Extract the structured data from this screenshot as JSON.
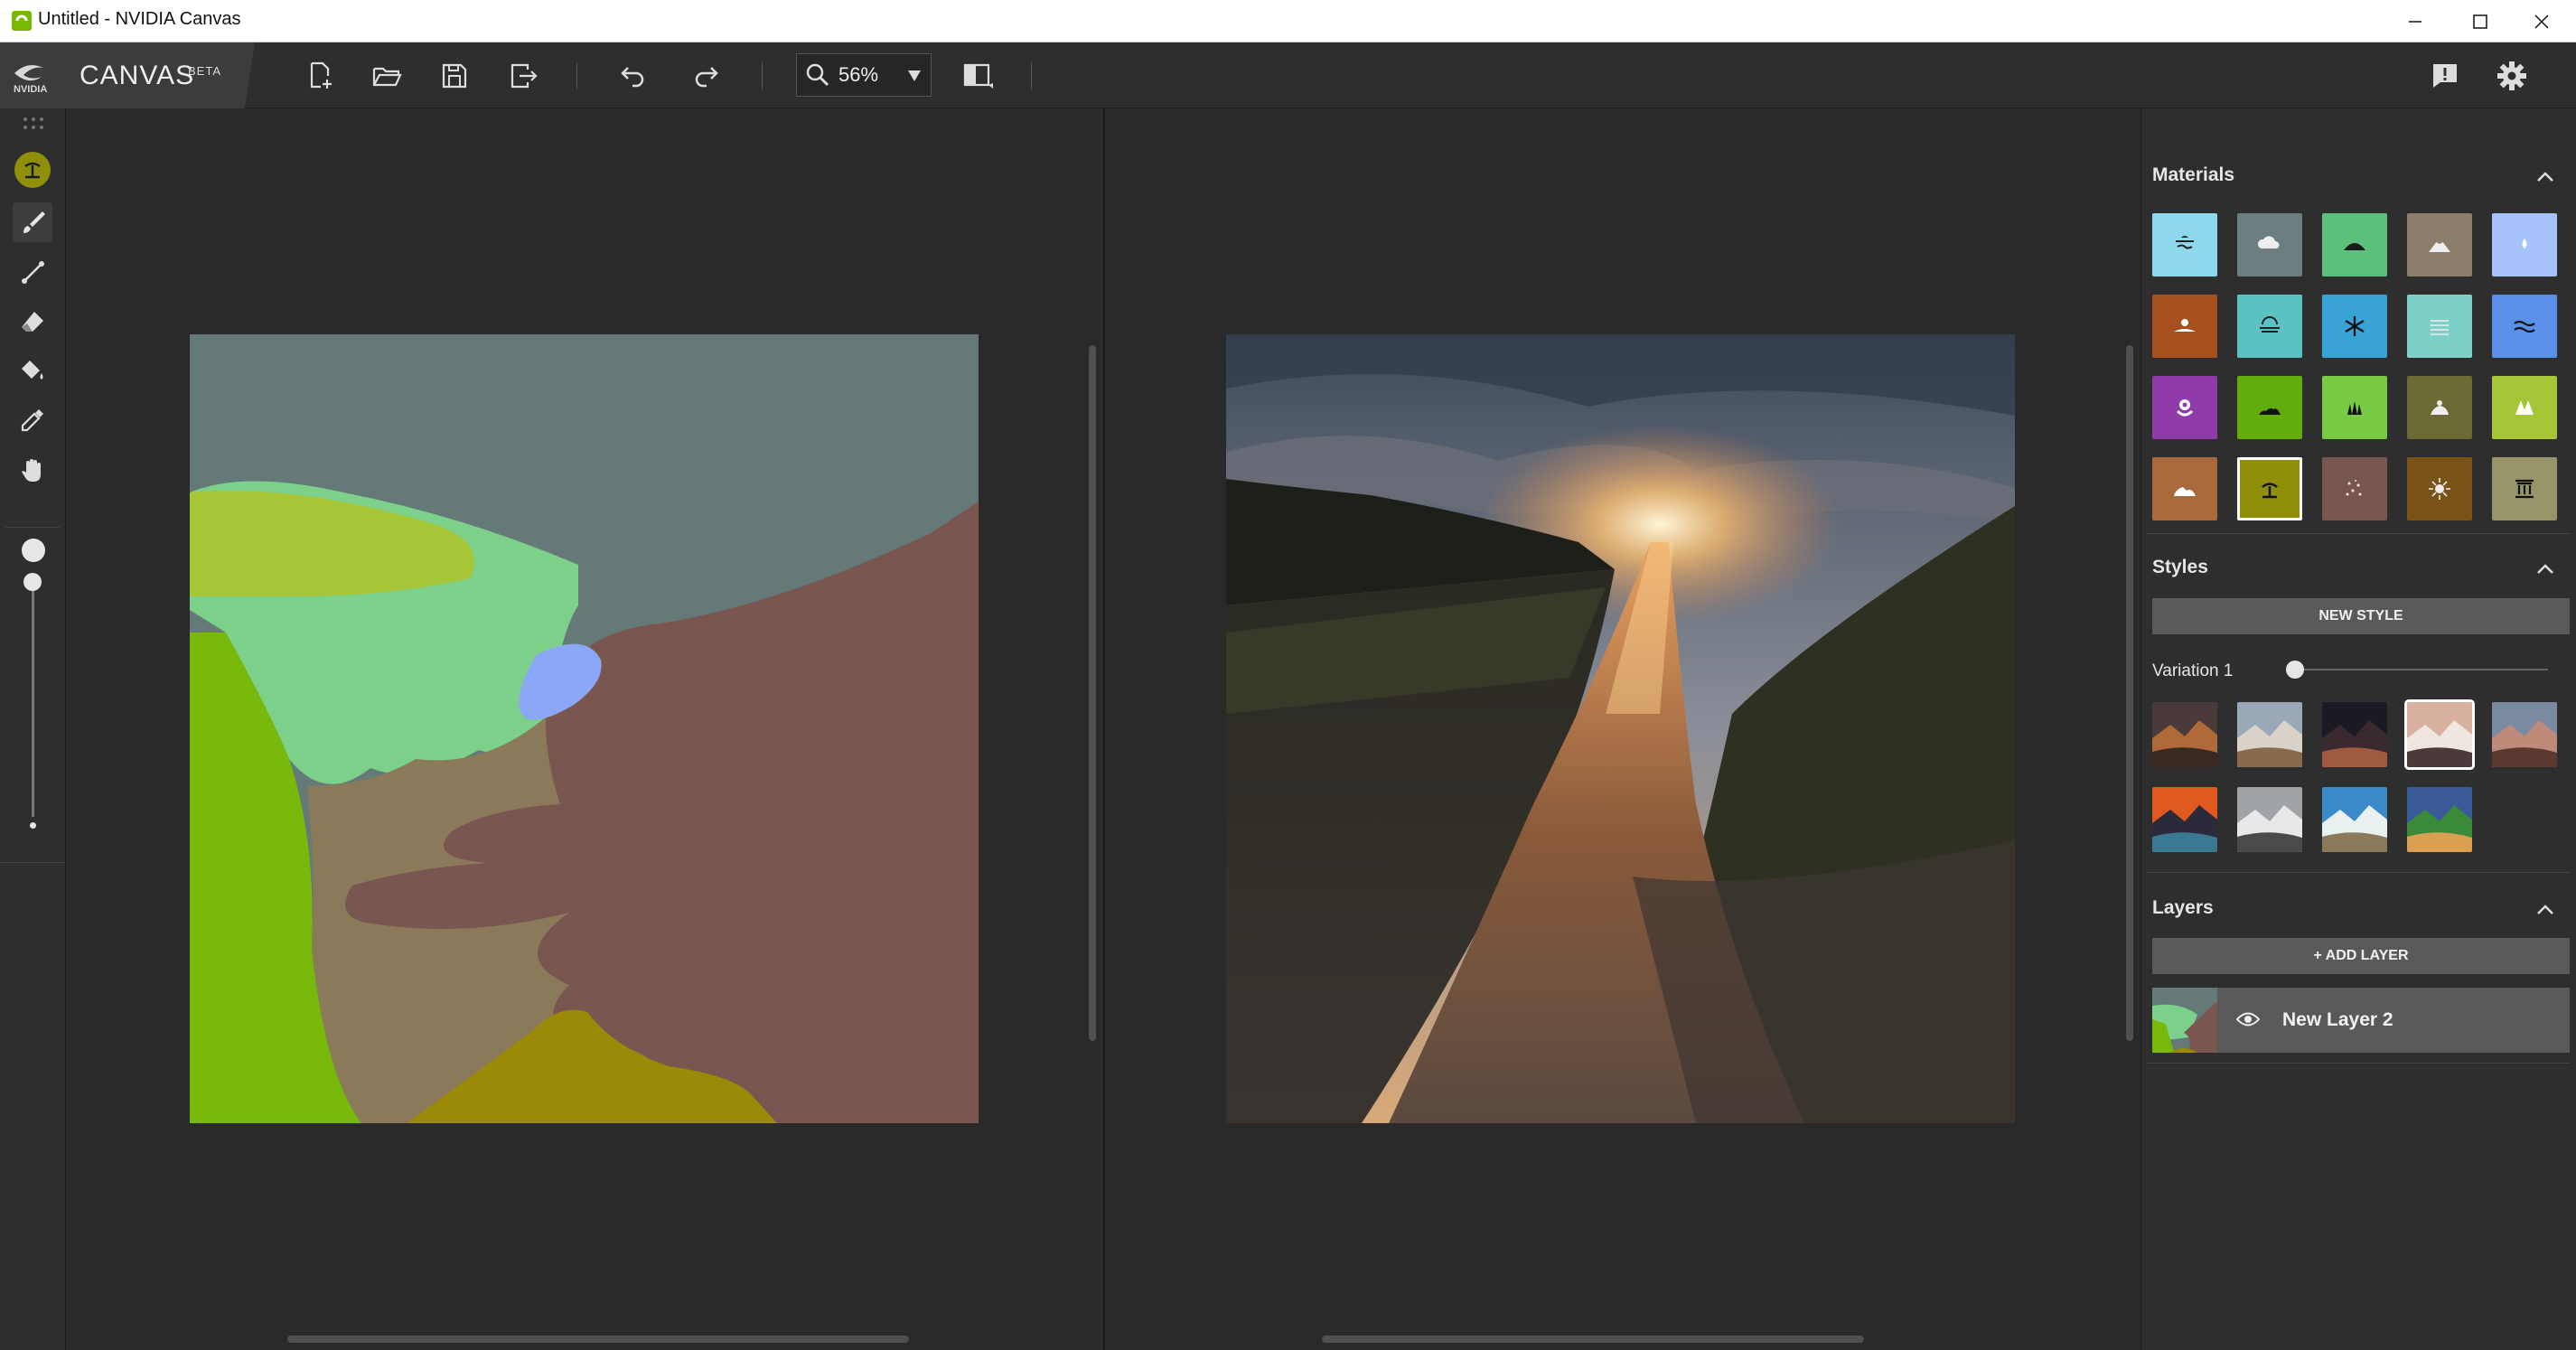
{
  "window": {
    "title": "Untitled - NVIDIA Canvas",
    "controls": [
      "minimize",
      "maximize",
      "close"
    ]
  },
  "brand": {
    "logo_text": "NVIDIA",
    "app_name": "CANVAS",
    "badge": "BETA"
  },
  "toolbar": {
    "buttons": [
      "new-file",
      "open-file",
      "save-file",
      "export-file",
      "undo",
      "redo",
      "toggle-view"
    ],
    "zoom": "56%",
    "right_buttons": [
      "feedback",
      "settings"
    ]
  },
  "tools": [
    "material-picker",
    "brush",
    "line",
    "eraser",
    "fill",
    "eyedropper",
    "pan"
  ],
  "brush_size": {
    "value_fraction": 0.0
  },
  "panels": {
    "materials": {
      "title": "Materials",
      "selected_index": 16,
      "items": [
        {
          "name": "sky",
          "color": "#8ed8ec",
          "icon": "sea-icon"
        },
        {
          "name": "cloud",
          "color": "#6b7f80",
          "icon": "cloud-icon"
        },
        {
          "name": "hill",
          "color": "#5dc07a",
          "icon": "hill-icon"
        },
        {
          "name": "mountain",
          "color": "#8b7e6b",
          "icon": "mountain-icon"
        },
        {
          "name": "water-drop",
          "color": "#a6c2fb",
          "icon": "drop-icon"
        },
        {
          "name": "sand-dune",
          "color": "#a8501d",
          "icon": "sand-icon"
        },
        {
          "name": "fog",
          "color": "#5ac2c0",
          "icon": "fog-icon"
        },
        {
          "name": "snow",
          "color": "#3aa3d6",
          "icon": "snowflake-icon"
        },
        {
          "name": "mist",
          "color": "#7fcfc9",
          "icon": "mist-icon"
        },
        {
          "name": "water",
          "color": "#5a90e8",
          "icon": "waves-icon"
        },
        {
          "name": "flower",
          "color": "#8f3ca8",
          "icon": "flower-icon"
        },
        {
          "name": "grass",
          "color": "#61ad0c",
          "icon": "grass-icon"
        },
        {
          "name": "plant",
          "color": "#78c943",
          "icon": "plant-icon"
        },
        {
          "name": "dirt",
          "color": "#6b6a35",
          "icon": "dirt-icon"
        },
        {
          "name": "tree",
          "color": "#a6c638",
          "icon": "tree-icon"
        },
        {
          "name": "rock",
          "color": "#a86a3b",
          "icon": "rock-icon"
        },
        {
          "name": "beach",
          "color": "#8f8f0a",
          "icon": "palm-icon"
        },
        {
          "name": "gravel",
          "color": "#7a5650",
          "icon": "sparkle-icon"
        },
        {
          "name": "stone",
          "color": "#7a5317",
          "icon": "burst-icon"
        },
        {
          "name": "building",
          "color": "#969468",
          "icon": "pillar-icon"
        }
      ]
    },
    "styles": {
      "title": "Styles",
      "new_style_label": "NEW STYLE",
      "variation_label": "Variation 1",
      "variation_fraction": 0.0,
      "selected_index": 3,
      "thumbnails": [
        {
          "name": "desert-dusk",
          "colors": [
            "#4a3a3a",
            "#b06a3a",
            "#3a2a22"
          ]
        },
        {
          "name": "snow-peaks",
          "colors": [
            "#9aa8b8",
            "#d8d2c8",
            "#8a6a4a"
          ]
        },
        {
          "name": "dark-arch",
          "colors": [
            "#1a1a22",
            "#3a2a30",
            "#a05a40"
          ]
        },
        {
          "name": "misty-valley",
          "colors": [
            "#d8b0a0",
            "#f0e6e0",
            "#4a3a3a"
          ]
        },
        {
          "name": "red-cliffs",
          "colors": [
            "#7a8aa0",
            "#c08a7a",
            "#5a3a30"
          ]
        },
        {
          "name": "ocean-sunset",
          "colors": [
            "#e05a20",
            "#2a2a3a",
            "#3a7a90"
          ]
        },
        {
          "name": "grey-range",
          "colors": [
            "#a0a4a8",
            "#e8e8e8",
            "#4a4a4a"
          ]
        },
        {
          "name": "tropical-coast",
          "colors": [
            "#3a8ac8",
            "#e8f0f0",
            "#8a7a5a"
          ]
        },
        {
          "name": "alpine-lake",
          "colors": [
            "#3a5a9a",
            "#3a8a3a",
            "#d8a050"
          ]
        }
      ]
    },
    "layers": {
      "title": "Layers",
      "add_label": "+ ADD LAYER",
      "items": [
        {
          "name": "New Layer 2",
          "visible": true
        }
      ]
    }
  }
}
